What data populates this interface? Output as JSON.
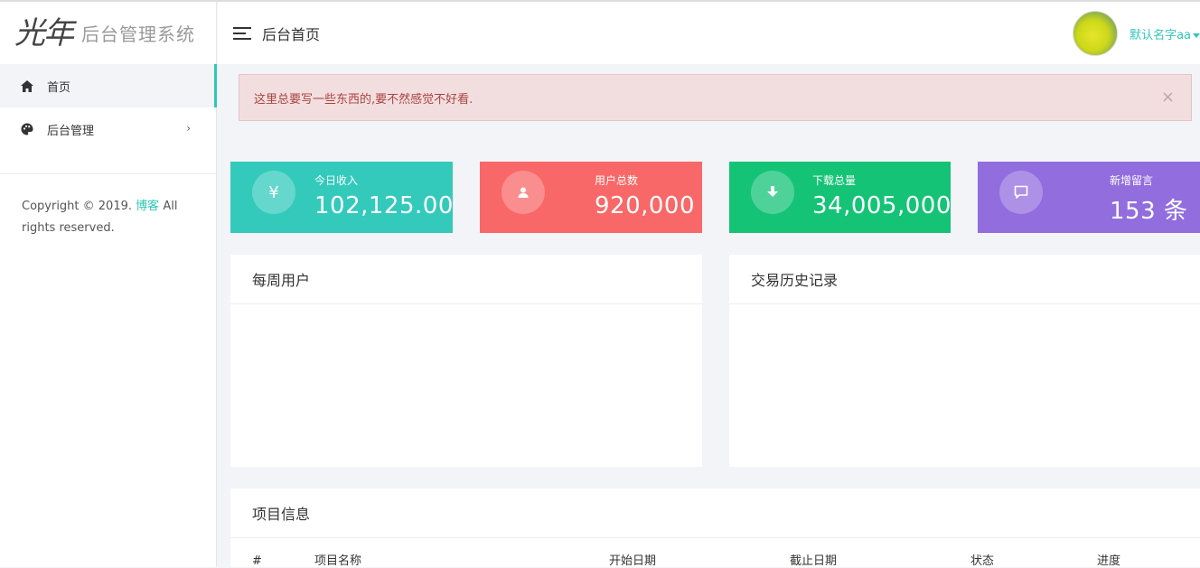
{
  "sidebar": {
    "logo_mark": "光年",
    "logo_text": "后台管理系统",
    "items": [
      {
        "label": "首页"
      },
      {
        "label": "后台管理"
      }
    ],
    "copyright_prefix": "Copyright © 2019.",
    "copyright_link": "博客",
    "copyright_suffix": "All rights reserved."
  },
  "header": {
    "title": "后台首页",
    "username": "默认名字aa"
  },
  "alert": {
    "text": "这里总要写一些东西的,要不然感觉不好看.",
    "close": "×"
  },
  "stats": [
    {
      "label": "今日收入",
      "value": "102,125.00",
      "color": "#33cabb",
      "icon": "yen-icon"
    },
    {
      "label": "用户总数",
      "value": "920,000",
      "color": "#f96868",
      "icon": "user-icon"
    },
    {
      "label": "下载总量",
      "value": "34,005,000",
      "color": "#15c377",
      "icon": "download-icon"
    },
    {
      "label": "新增留言",
      "value": "153 条",
      "color": "#926dde",
      "icon": "message-icon"
    }
  ],
  "panels": {
    "weekly_users": "每周用户",
    "transactions": "交易历史记录",
    "projects": "项目信息"
  },
  "project_table": {
    "columns": [
      "#",
      "项目名称",
      "开始日期",
      "截止日期",
      "状态",
      "进度"
    ]
  }
}
